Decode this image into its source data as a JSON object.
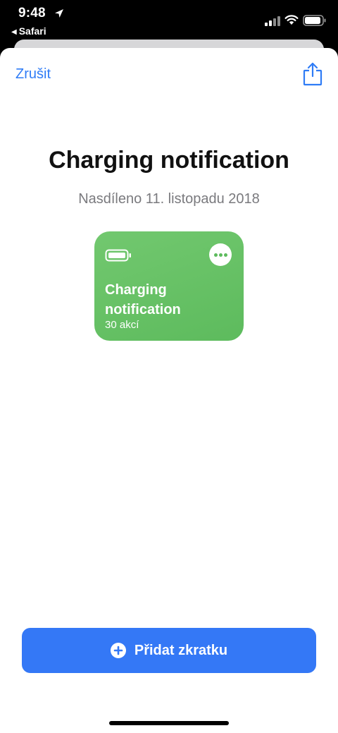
{
  "status_bar": {
    "time": "9:48",
    "back_app": "Safari"
  },
  "header": {
    "cancel_label": "Zrušit",
    "share_icon": "share-icon"
  },
  "shortcut": {
    "title": "Charging notification",
    "shared_date": "Nasdíleno 11. listopadu 2018",
    "tile_name": "Charging notification",
    "tile_actions": "30 akcí",
    "tile_icon": "battery-icon",
    "tile_color": "#66c165"
  },
  "primary_action": {
    "label": "Přidat zkratku",
    "icon": "plus-circle-icon",
    "color": "#3478f6"
  }
}
